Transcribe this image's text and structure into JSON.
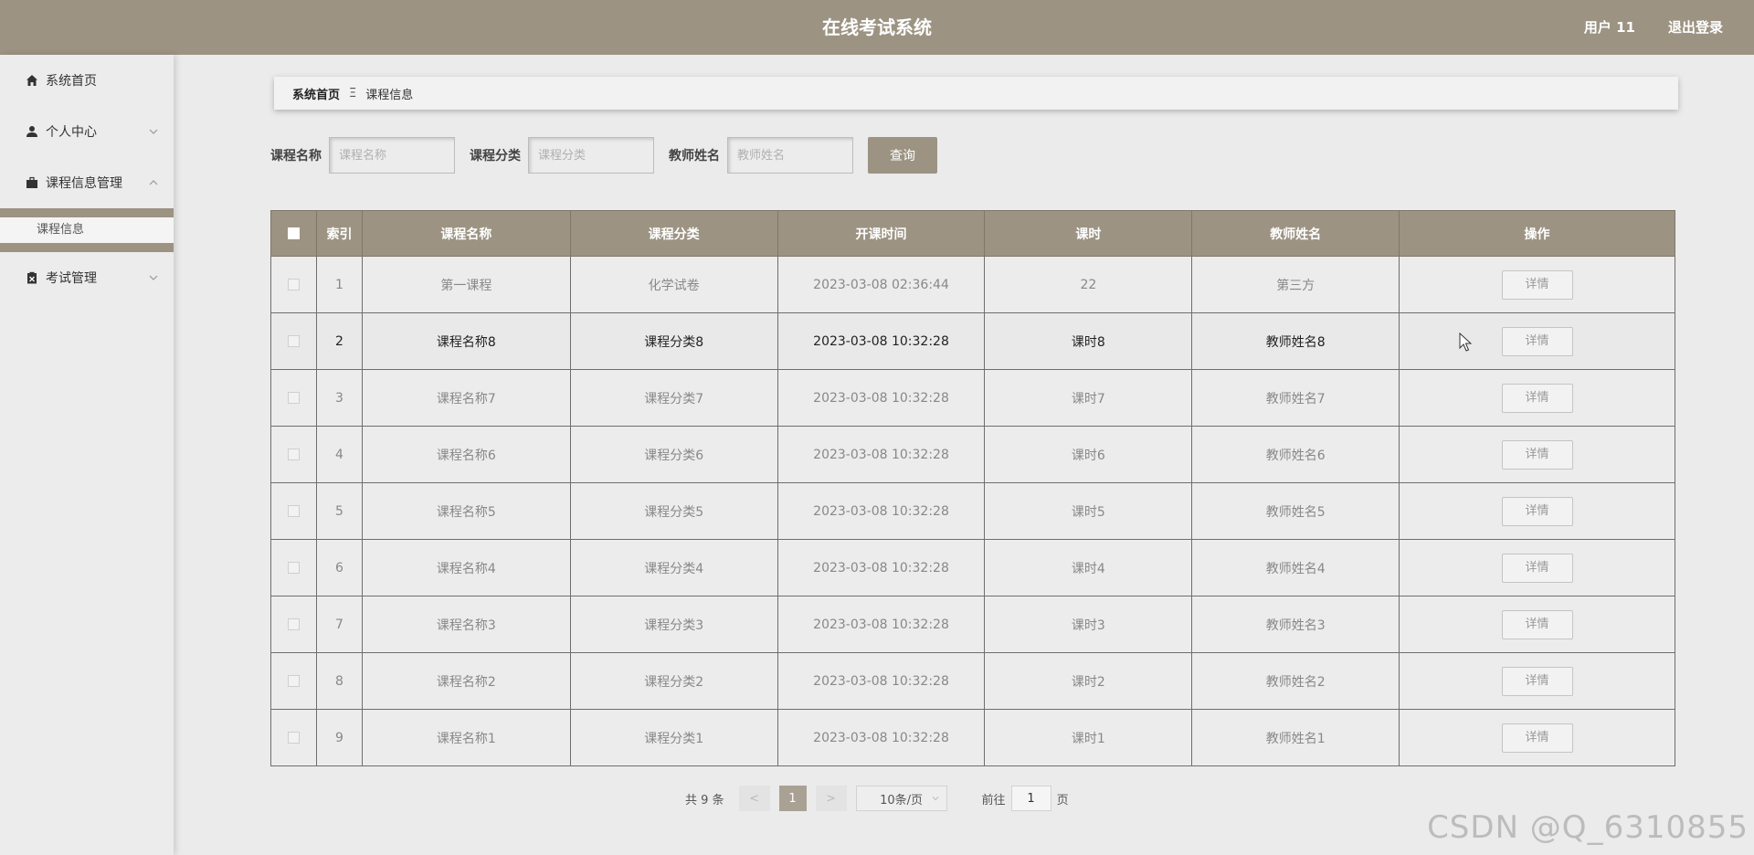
{
  "header": {
    "title": "在线考试系统",
    "user": "用户 11",
    "logout": "退出登录"
  },
  "sidebar": {
    "home": "系统首页",
    "personal": "个人中心",
    "course_mgmt": "课程信息管理",
    "course_info": "课程信息",
    "exam_mgmt": "考试管理"
  },
  "breadcrumb": {
    "home": "系统首页",
    "separator": "Ξ",
    "current": "课程信息"
  },
  "search": {
    "course_name_label": "课程名称",
    "course_name_placeholder": "课程名称",
    "category_label": "课程分类",
    "category_placeholder": "课程分类",
    "teacher_label": "教师姓名",
    "teacher_placeholder": "教师姓名",
    "query_button": "查询"
  },
  "table": {
    "columns": [
      "索引",
      "课程名称",
      "课程分类",
      "开课时间",
      "课时",
      "教师姓名",
      "操作"
    ],
    "detail_label": "详情",
    "rows": [
      [
        "1",
        "第一课程",
        "化学试卷",
        "2023-03-08 02:36:44",
        "22",
        "第三方"
      ],
      [
        "2",
        "课程名称8",
        "课程分类8",
        "2023-03-08 10:32:28",
        "课时8",
        "教师姓名8"
      ],
      [
        "3",
        "课程名称7",
        "课程分类7",
        "2023-03-08 10:32:28",
        "课时7",
        "教师姓名7"
      ],
      [
        "4",
        "课程名称6",
        "课程分类6",
        "2023-03-08 10:32:28",
        "课时6",
        "教师姓名6"
      ],
      [
        "5",
        "课程名称5",
        "课程分类5",
        "2023-03-08 10:32:28",
        "课时5",
        "教师姓名5"
      ],
      [
        "6",
        "课程名称4",
        "课程分类4",
        "2023-03-08 10:32:28",
        "课时4",
        "教师姓名4"
      ],
      [
        "7",
        "课程名称3",
        "课程分类3",
        "2023-03-08 10:32:28",
        "课时3",
        "教师姓名3"
      ],
      [
        "8",
        "课程名称2",
        "课程分类2",
        "2023-03-08 10:32:28",
        "课时2",
        "教师姓名2"
      ],
      [
        "9",
        "课程名称1",
        "课程分类1",
        "2023-03-08 10:32:28",
        "课时1",
        "教师姓名1"
      ]
    ]
  },
  "pagination": {
    "total": "共 9 条",
    "prev": "<",
    "current_page": "1",
    "next": ">",
    "page_size": "10条/页",
    "goto_label": "前往",
    "goto_value": "1",
    "page_suffix": "页"
  },
  "watermark": "CSDN @Q_6310855",
  "colors": {
    "accent": "#9c9383",
    "background": "#ebebeb"
  }
}
